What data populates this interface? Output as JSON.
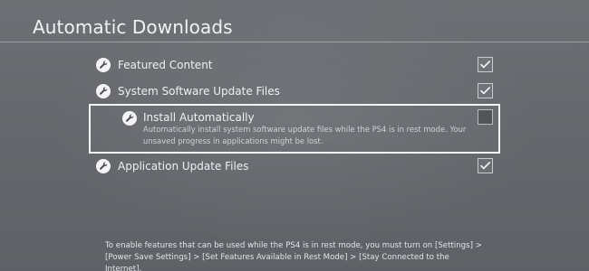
{
  "header": {
    "title": "Automatic Downloads"
  },
  "settings": [
    {
      "label": "Featured Content",
      "icon": "wrench-icon",
      "checked": true
    },
    {
      "label": "System Software Update Files",
      "icon": "wrench-icon",
      "checked": true
    },
    {
      "label": "Install Automatically",
      "icon": "wrench-icon",
      "checked": false,
      "focused": true,
      "description": "Automatically install system software update files while the PS4 is in rest mode. Your unsaved progress in applications might be lost."
    },
    {
      "label": "Application Update Files",
      "icon": "wrench-icon",
      "checked": true
    }
  ],
  "footer": {
    "note": "To enable features that can be used while the PS4 is in rest mode, you must turn on [Settings] > [Power Save Settings] > [Set Features Available in Rest Mode] > [Stay Connected to the Internet]."
  },
  "colors": {
    "background": "#66686d",
    "text": "#eef0f2",
    "focus_border": "#f3f4f6"
  }
}
